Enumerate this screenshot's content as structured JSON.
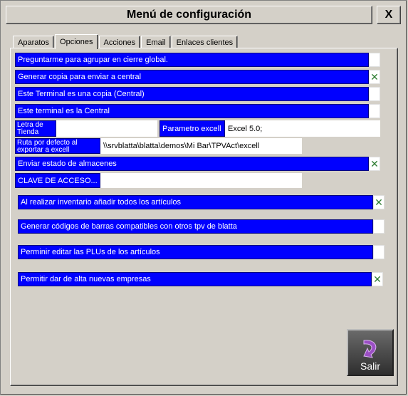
{
  "window": {
    "title": "Menú de configuración",
    "close_label": "X"
  },
  "tabs": [
    {
      "label": "Aparatos",
      "active": false
    },
    {
      "label": "Opciones",
      "active": true
    },
    {
      "label": "Acciones",
      "active": false
    },
    {
      "label": "Email",
      "active": false
    },
    {
      "label": "Enlaces clientes",
      "active": false
    }
  ],
  "options": {
    "agrupar": {
      "label": "Preguntarme para agrupar en cierre global.",
      "checked": false
    },
    "copia": {
      "label": "Generar copia para enviar a central",
      "checked": true
    },
    "es_copia": {
      "label": "Este Terminal es una copia (Central)",
      "checked": false
    },
    "es_central": {
      "label": "Este terminal es la Central",
      "checked": false
    },
    "almacenes": {
      "label": "Enviar estado de almacenes",
      "checked": true
    },
    "inventario": {
      "label": "Al realizar inventario añadir todos los artículos",
      "checked": true
    },
    "barras": {
      "label": "Generar códigos de barras compatibles con otros tpv de blatta",
      "checked": false
    },
    "plus": {
      "label": "Perminir editar las PLUs de los artículos",
      "checked": false
    },
    "empresas": {
      "label": "Permitir dar de alta nuevas empresas",
      "checked": true
    }
  },
  "fields": {
    "letra_tienda": {
      "label": "Letra de Tienda",
      "value": ""
    },
    "parametro_excell": {
      "label": "Parametro excell",
      "value": "Excel 5.0;"
    },
    "ruta_excell": {
      "label": "Ruta por defecto al exportar a excell",
      "value": "\\\\srvblatta\\blatta\\demos\\Mi Bar\\TPVAct\\excell"
    },
    "clave": {
      "label": "CLAVE DE ACCESO...",
      "value": ""
    }
  },
  "check_mark": "✕",
  "exit_button": {
    "label": "Salir",
    "icon": "return-arrow-icon",
    "color": "#9b4fc4"
  }
}
